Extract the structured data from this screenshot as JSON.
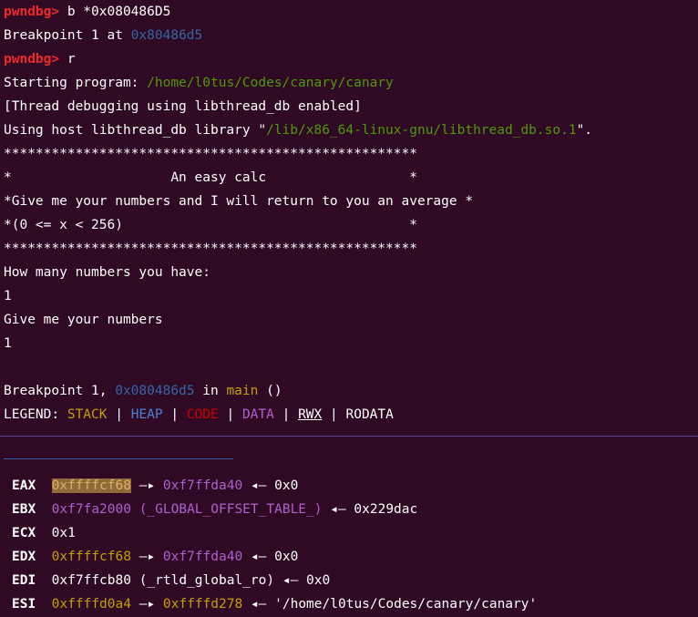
{
  "terminal": {
    "prompt": "pwndbg>",
    "cmd1": " b *0x080486D5",
    "bp_set_prefix": "Breakpoint 1 at ",
    "bp_set_addr": "0x80486d5",
    "cmd2": " r",
    "start_prefix": "Starting program: ",
    "start_path": "/home/l0tus/Codes/canary/canary",
    "thread_line": "[Thread debugging using libthread_db enabled]",
    "host_prefix": "Using host libthread_db library \"",
    "host_path": "/lib/x86_64-linux-gnu/libthread_db.so.1",
    "host_suffix": "\".",
    "program_output": [
      "****************************************************",
      "*                    An easy calc                  *",
      "*Give me your numbers and I will return to you an average *",
      "*(0 <= x < 256)                                    *",
      "****************************************************",
      "How many numbers you have:",
      "1",
      "Give me your numbers",
      "1"
    ],
    "bp_hit_prefix": "Breakpoint 1, ",
    "bp_hit_addr": "0x080486d5",
    "bp_hit_in": " in ",
    "bp_hit_fn": "main",
    "bp_hit_suffix": " ()",
    "legend": {
      "label": "LEGEND: ",
      "stack": "STACK",
      "heap": "HEAP",
      "code": "CODE",
      "data": "DATA",
      "rwx": "RWX",
      "rodata": "RODATA",
      "sep": " | "
    },
    "registers": [
      {
        "name": "EAX",
        "v1": "0xffffcf68",
        "arrow1": " —▸ ",
        "v2": "0xf7ffda40",
        "arrow2": " ◂— ",
        "v3": "0x0"
      },
      {
        "name": "EBX",
        "v1": "0xf7fa2000 (_GLOBAL_OFFSET_TABLE_)",
        "arrow1": "",
        "v2": "",
        "arrow2": " ◂— ",
        "v3": "0x229dac"
      },
      {
        "name": "ECX",
        "v1": "0x1",
        "arrow1": "",
        "v2": "",
        "arrow2": "",
        "v3": ""
      },
      {
        "name": "EDX",
        "v1": "0xffffcf68",
        "arrow1": " —▸ ",
        "v2": "0xf7ffda40",
        "arrow2": " ◂— ",
        "v3": "0x0"
      },
      {
        "name": "EDI",
        "v1": "0xf7ffcb80 (_rtld_global_ro)",
        "arrow1": "",
        "v2": "",
        "arrow2": " ◂— ",
        "v3": "0x0"
      },
      {
        "name": "ESI",
        "v1": "0xffffd0a4",
        "arrow1": " —▸ ",
        "v2": "0xffffd278",
        "arrow2": " ◂— ",
        "v3": "'/home/l0tus/Codes/canary/canary'"
      }
    ]
  }
}
